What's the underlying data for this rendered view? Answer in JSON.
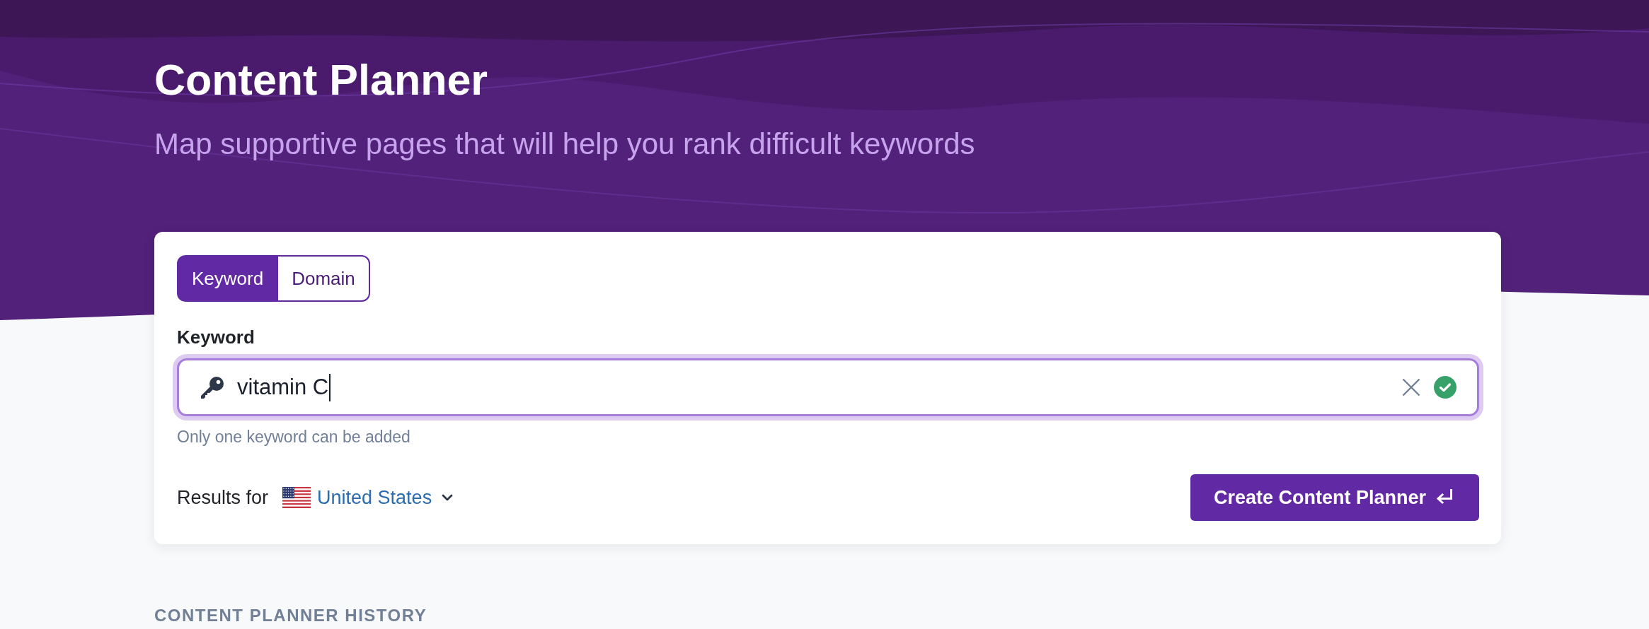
{
  "header": {
    "title": "Content Planner",
    "subtitle": "Map supportive pages that will help you rank difficult keywords"
  },
  "mode_tabs": [
    {
      "label": "Keyword",
      "selected": true
    },
    {
      "label": "Domain",
      "selected": false
    }
  ],
  "keyword_field": {
    "label": "Keyword",
    "value": "vitamin C",
    "focused": true,
    "valid": true,
    "hint": "Only one keyword can be added"
  },
  "results_for": {
    "label": "Results for",
    "country": "United States"
  },
  "submit_button": {
    "label": "Create Content Planner"
  },
  "history": {
    "heading": "CONTENT PLANNER HISTORY"
  }
}
